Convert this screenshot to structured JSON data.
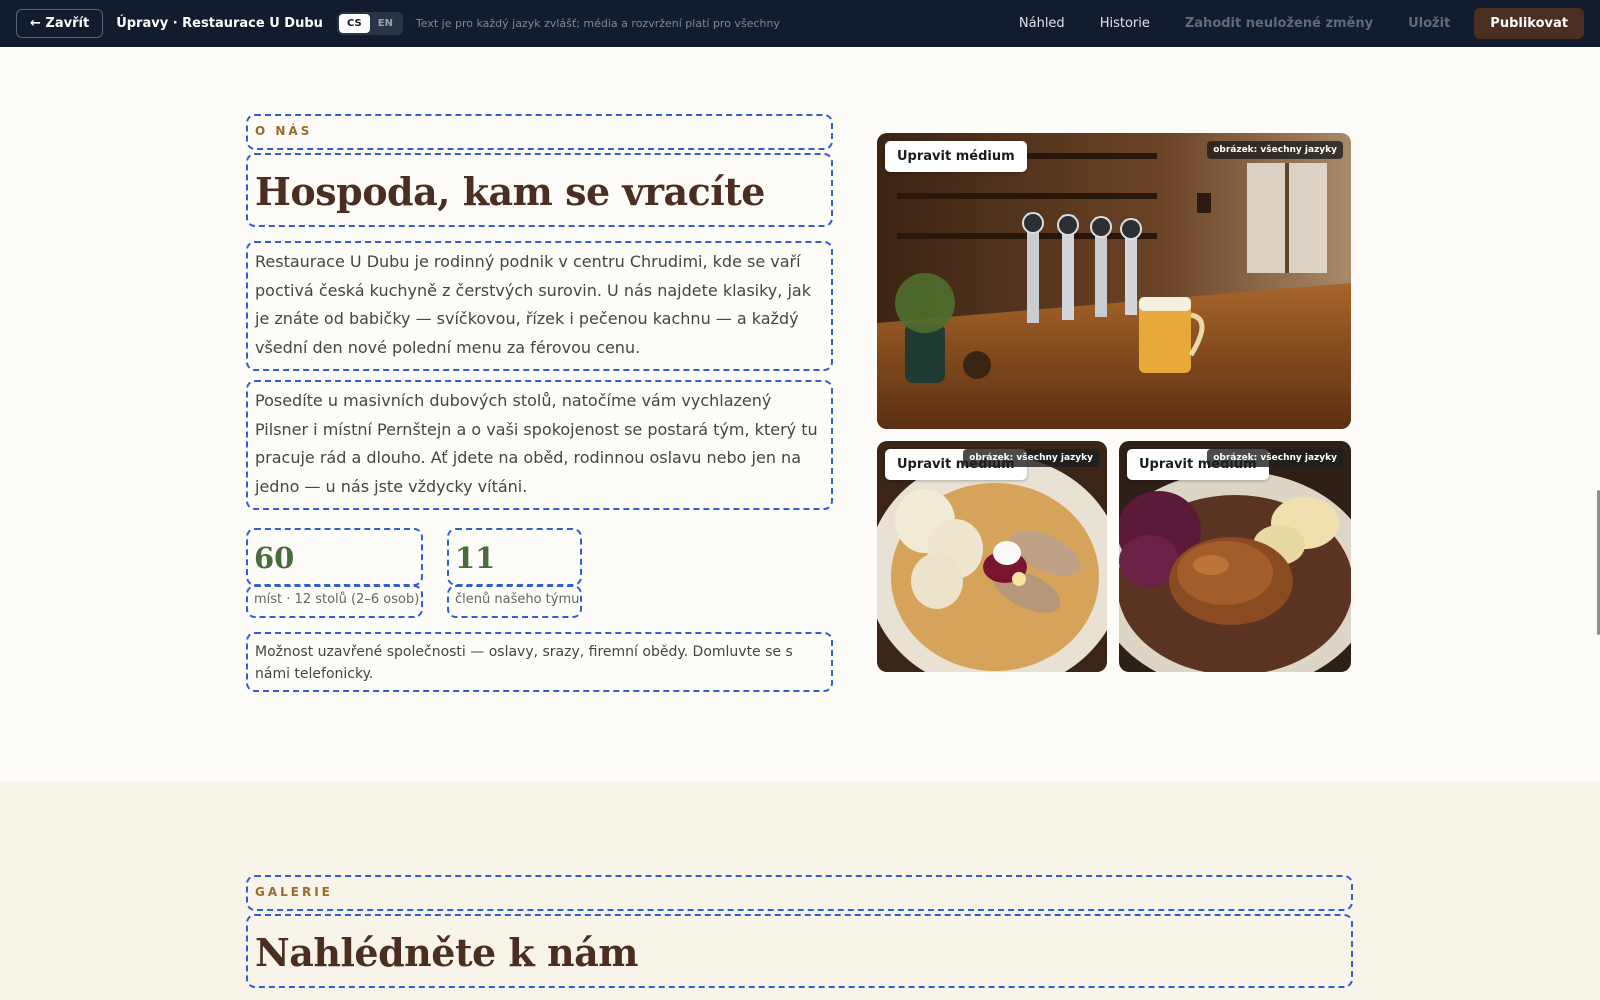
{
  "topbar": {
    "close_label": "← Zavřít",
    "title": "Úpravy · Restaurace U Dubu",
    "languages": [
      "CS",
      "EN"
    ],
    "active_language": "CS",
    "language_note": "Text je pro každý jazyk zvlášť; média a rozvržení platí pro všechny",
    "preview_label": "Náhled",
    "history_label": "Historie",
    "discard_label": "Zahodit neuložené změny",
    "save_label": "Uložit",
    "publish_label": "Publikovat"
  },
  "about": {
    "eyebrow": "O NÁS",
    "heading": "Hospoda, kam se vracíte",
    "paragraph1": "Restaurace U Dubu je rodinný podnik v centru Chrudimi, kde se vaří poctivá česká kuchyně z čerstvých surovin. U nás najdete klasiky, jak je znáte od babičky — svíčkovou, řízek i pečenou kachnu — a každý všední den nové polední menu za férovou cenu.",
    "paragraph2": "Posedíte u masivních dubových stolů, natočíme vám vychlazený Pilsner i místní Pernštejn a o vaši spokojenost se postará tým, který tu pracuje rád a dlouho. Ať jdete na oběd, rodinnou oslavu nebo jen na jedno — u nás jste vždycky vítáni.",
    "stats": [
      {
        "value": "60",
        "caption": "míst · 12 stolů (2–6 osob)"
      },
      {
        "value": "11",
        "caption": "členů našeho týmu"
      }
    ],
    "note": "Možnost uzavřené společnosti — oslavy, srazy, firemní obědy. Domluvte se s námi telefonicky."
  },
  "media": {
    "edit_label": "Upravit médium",
    "scope_tag": "obrázek: všechny jazyky",
    "images": [
      "bar-tap-image",
      "svickova-image",
      "duck-image"
    ]
  },
  "gallery": {
    "eyebrow": "GALERIE",
    "heading": "Nahlédněte k nám"
  },
  "colors": {
    "topbar": "#121c2e",
    "publish": "#4b2e1f",
    "edit_outline": "#2f5fd0",
    "heading": "#4b2e1f",
    "eyebrow": "#9a6a2c",
    "stat": "#4a6b3d"
  }
}
